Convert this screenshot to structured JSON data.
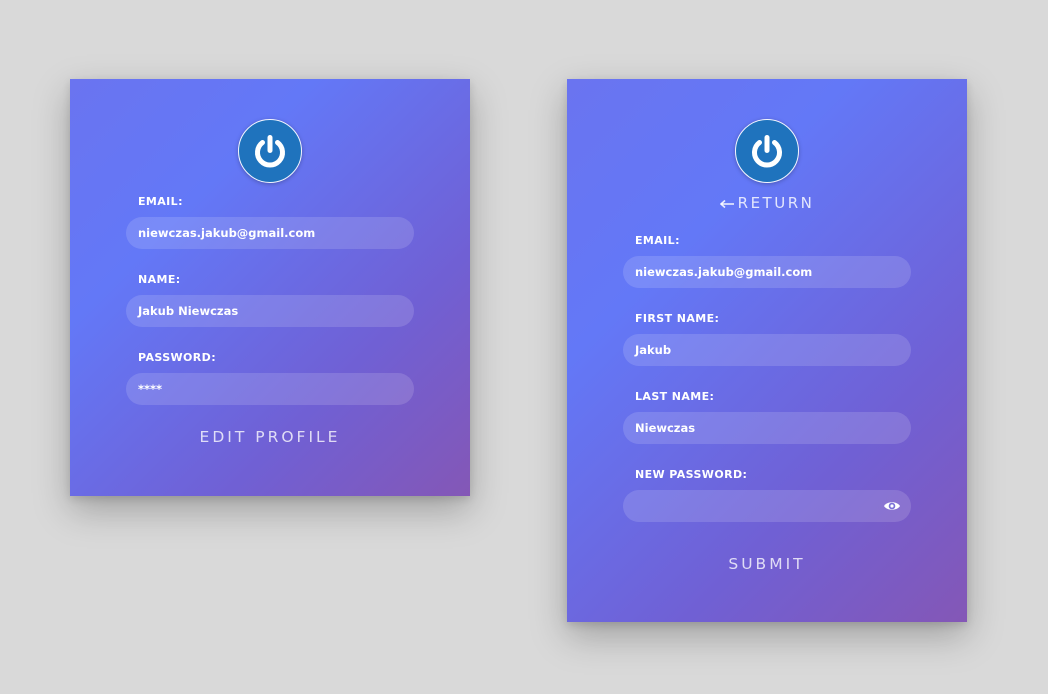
{
  "view_card": {
    "logo_icon": "power-icon",
    "email_label": "EMAIL:",
    "email_value": "niewczas.jakub@gmail.com",
    "name_label": "NAME:",
    "name_value": "Jakub Niewczas",
    "password_label": "PASSWORD:",
    "password_value": "****",
    "edit_label": "EDIT PROFILE"
  },
  "edit_card": {
    "logo_icon": "power-icon",
    "return_label": "RETURN",
    "email_label": "EMAIL:",
    "email_value": "niewczas.jakub@gmail.com",
    "first_name_label": "FIRST NAME:",
    "first_name_value": "Jakub",
    "last_name_label": "LAST NAME:",
    "last_name_value": "Niewczas",
    "new_password_label": "NEW PASSWORD:",
    "new_password_value": "",
    "eye_icon": "eye-icon",
    "submit_label": "SUBMIT"
  },
  "colors": {
    "background": "#d9d9d9",
    "card_gradient_start": "#6378f7",
    "card_gradient_end": "#8457b6",
    "logo_blue": "#1f73bd"
  }
}
